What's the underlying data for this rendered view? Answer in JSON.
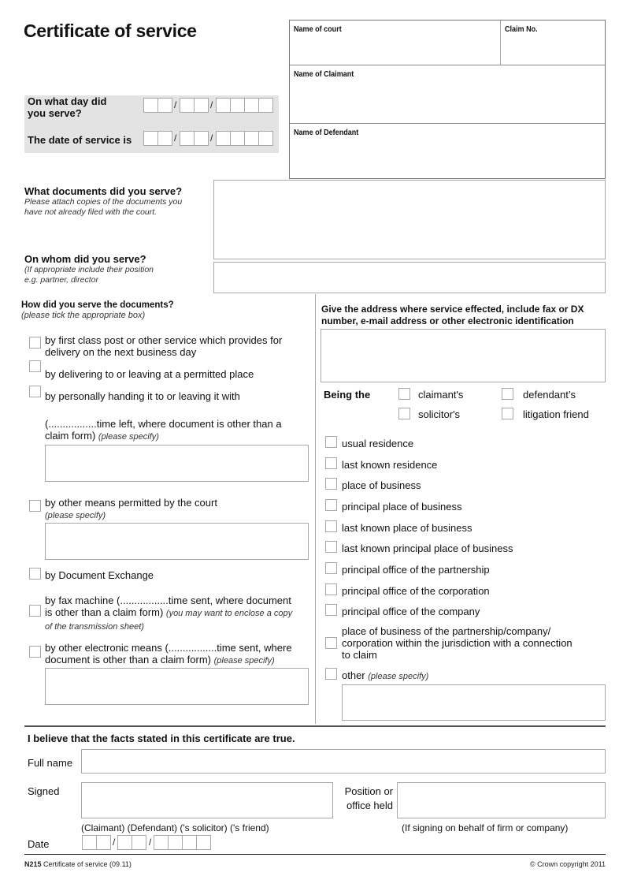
{
  "form": {
    "title": "Certificate of service",
    "court_panel": {
      "name_of_court": "Name of court",
      "claim_no": "Claim No.",
      "name_of_claimant": "Name of Claimant",
      "name_of_defendant": "Name of Defendant"
    },
    "date_panel": {
      "day_served_label_line1": "On what day did",
      "day_served_label_line2": "you serve?",
      "date_of_service_label": "The date of service is",
      "slash": "/"
    },
    "documents": {
      "label": "What documents did you serve?",
      "sub_line1": "Please attach copies of the documents you",
      "sub_line2": "have not already filed with the court."
    },
    "whom": {
      "label": "On whom did you serve?",
      "sub_line1": "(If appropriate include their position",
      "sub_line2": "e.g. partner, director"
    },
    "how": {
      "label": "How did you serve the documents?",
      "sub": "(please tick the appropriate box)",
      "options": [
        {
          "line1": "by first class post or other service which provides for",
          "line2": "delivery on the next business day"
        },
        {
          "line1": "by delivering to or leaving at a permitted place"
        },
        {
          "line1": "by personally handing it to or leaving it with"
        },
        {
          "line1": "(.................time left, where document is other than a",
          "line2": "claim form)",
          "note": "(please specify)"
        },
        {
          "line1": "by other means permitted by the court",
          "note": "(please specify)"
        },
        {
          "line1": "by Document Exchange"
        },
        {
          "line1": "by fax machine (.................time sent, where document",
          "line2": "is other than a claim form)",
          "note": "(you may want to enclose a copy",
          "note2": "of the transmission sheet)"
        },
        {
          "line1": "by other electronic means (.................time sent, where",
          "line2": "document is other than a claim form)",
          "note": "(please specify)"
        }
      ]
    },
    "address": {
      "label_line1": "Give the address where service effected, include fax or DX",
      "label_line2": "number, e-mail address or other electronic identification",
      "being_the": "Being the",
      "roles": [
        "claimant's",
        "defendant’s",
        "solicitor's",
        "litigation friend"
      ],
      "places": [
        "usual residence",
        "last known residence",
        "place of business",
        "principal place of business",
        "last known place of business",
        "last known principal place of business",
        "principal office of the partnership",
        "principal office of the corporation",
        "principal office of the company"
      ],
      "place_jurisdiction_line1": "place of business of the partnership/company/",
      "place_jurisdiction_line2": "corporation within the jurisdiction with a connection",
      "place_jurisdiction_line3": "to claim",
      "other": "other",
      "other_note": "(please specify)"
    },
    "statement": {
      "truth": "I believe that the facts stated in this certificate are true.",
      "full_name": "Full name",
      "signed": "Signed",
      "position_line1": "Position or",
      "position_line2": "office held",
      "signer_roles": "(Claimant) (Defendant) ('s solicitor) ('s friend)",
      "behalf_note": "(If signing on behalf of firm or company)",
      "date": "Date"
    },
    "footer": {
      "form_code": "N215",
      "form_name": "Certificate of service (09.11)",
      "copyright": "© Crown copyright 2011"
    }
  }
}
